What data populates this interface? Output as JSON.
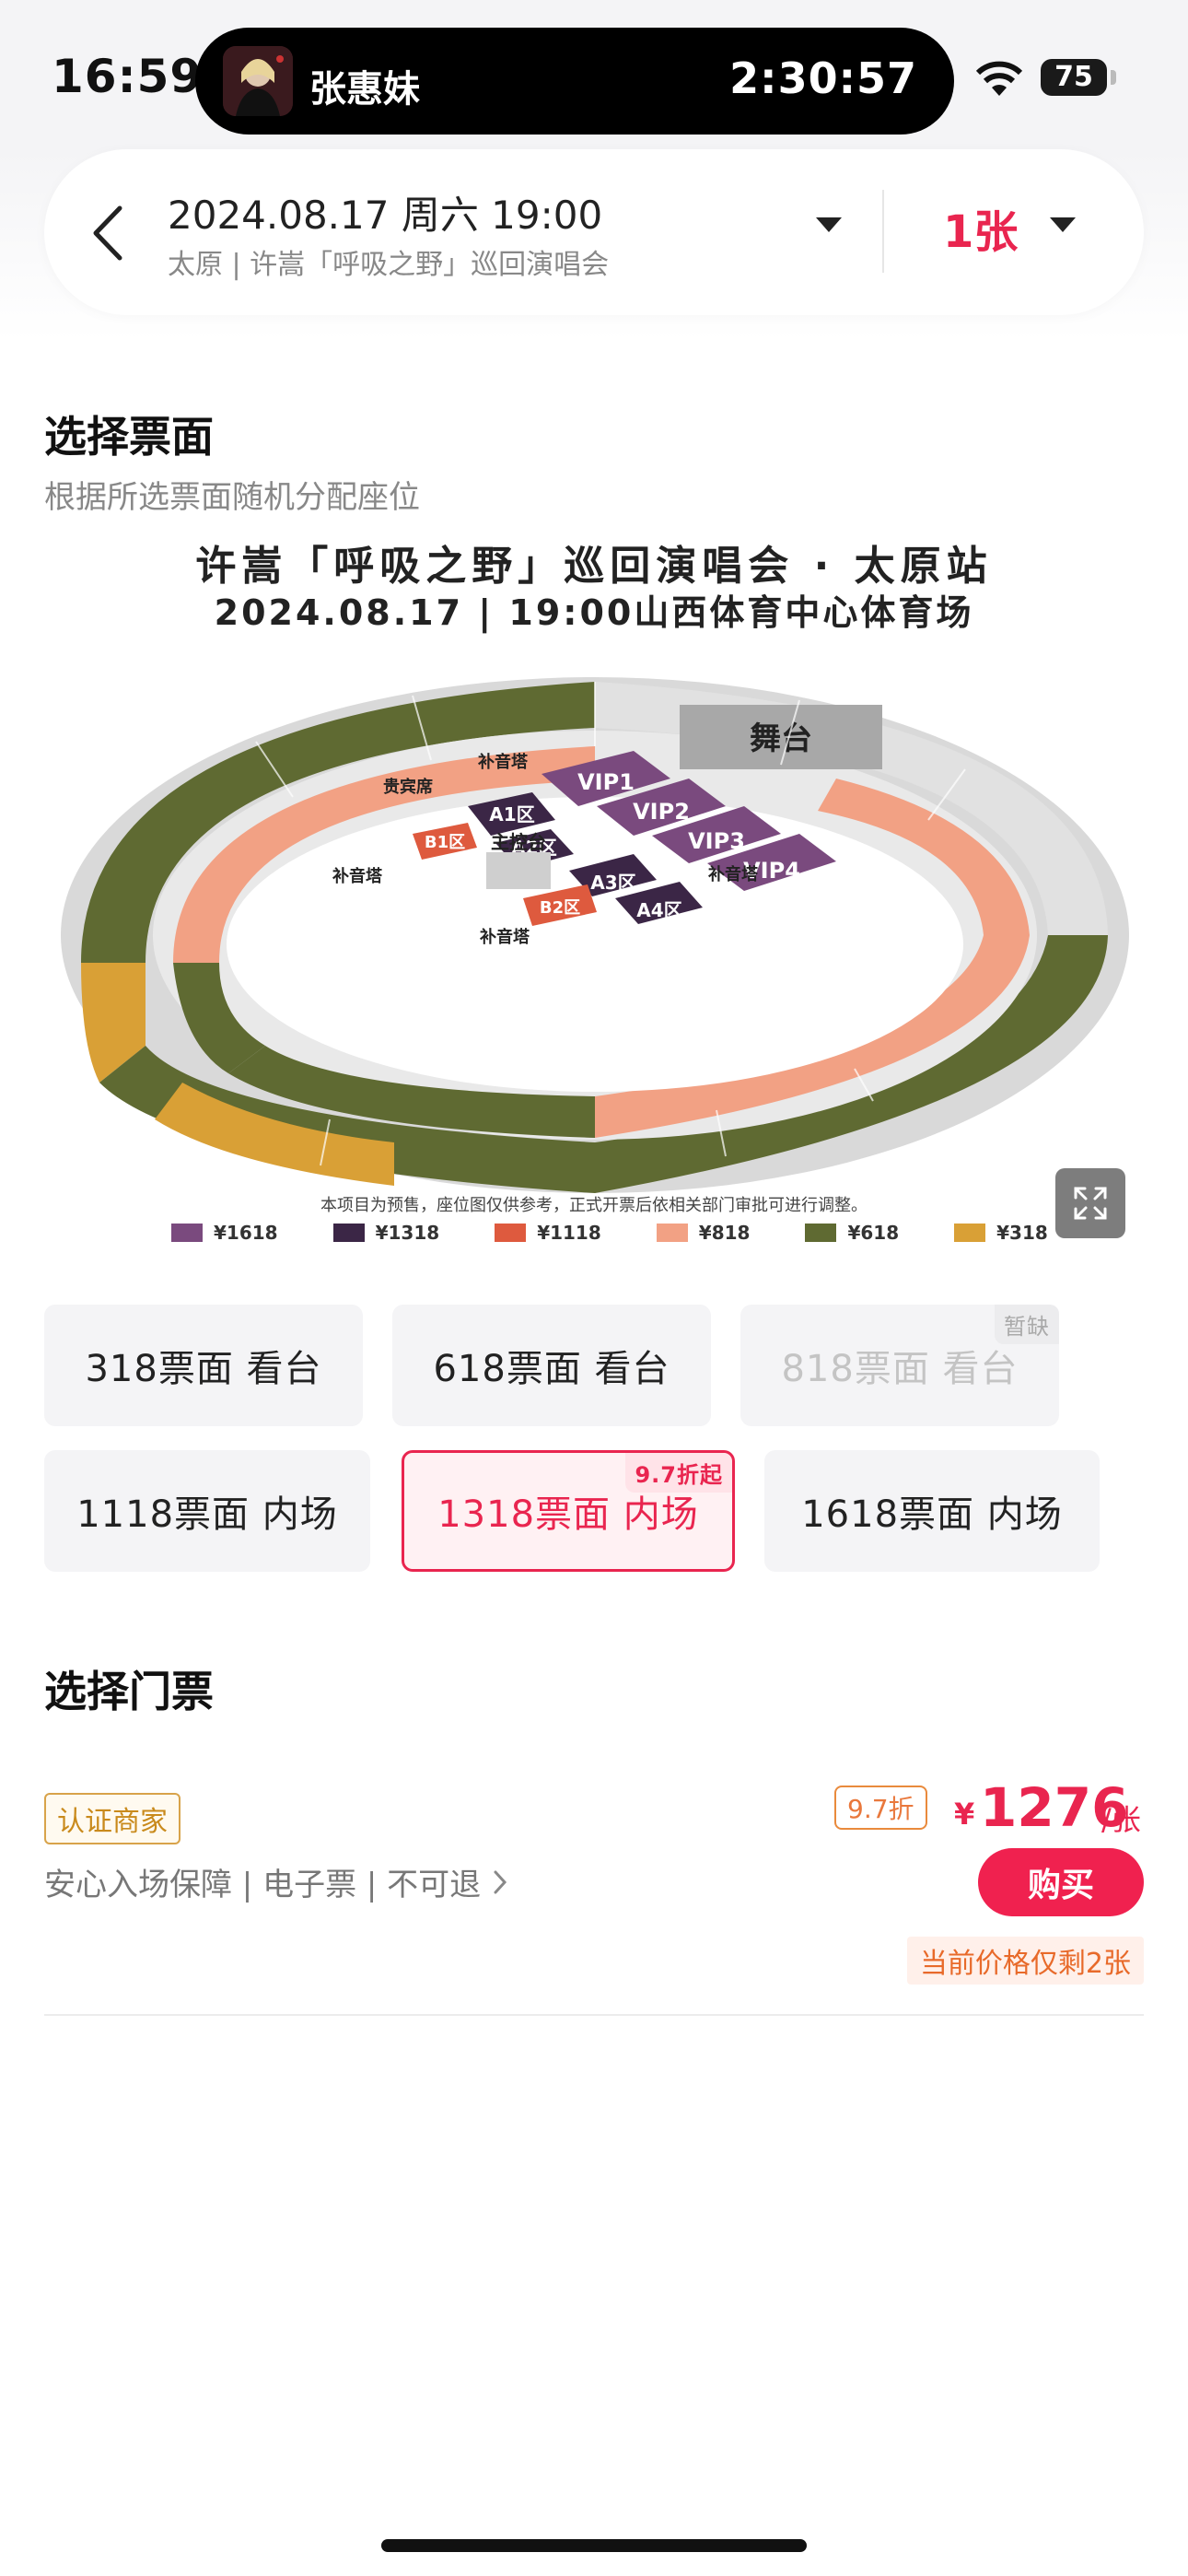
{
  "status_bar": {
    "time": "16:59",
    "battery": "75"
  },
  "live_activity": {
    "artist": "张惠妹",
    "timer": "2:30:57"
  },
  "header": {
    "date": "2024.08.17 周六 19:00",
    "subtitle": "太原 | 许嵩「呼吸之野」巡回演唱会",
    "quantity": "1张"
  },
  "seat_section": {
    "title": "选择票面",
    "subtitle": "根据所选票面随机分配座位"
  },
  "seat_map": {
    "title": "许嵩「呼吸之野」巡回演唱会 · 太原站",
    "subtitle": "2024.08.17 | 19:00山西体育中心体育场",
    "note": "本项目为预售，座位图仅供参考，正式开票后依相关部门审批可进行调整。",
    "stage": "舞台",
    "control": "主控台",
    "tower": "补音塔",
    "vip_box": "贵宾席",
    "legend": [
      {
        "label": "¥1618",
        "color": "#7a4a7e"
      },
      {
        "label": "¥1318",
        "color": "#3b2646"
      },
      {
        "label": "¥1118",
        "color": "#de5a3e"
      },
      {
        "label": "¥818",
        "color": "#f2a184"
      },
      {
        "label": "¥618",
        "color": "#5f6a32"
      },
      {
        "label": "¥318",
        "color": "#d9a036"
      }
    ],
    "sections": {
      "vip": [
        "VIP1",
        "VIP2",
        "VIP3",
        "VIP4"
      ],
      "a": [
        "A1区",
        "A2区",
        "A3区",
        "A4区"
      ],
      "b": [
        "B1区",
        "B2区"
      ]
    }
  },
  "tiers": [
    {
      "label": "318票面 看台",
      "badge": ""
    },
    {
      "label": "618票面 看台",
      "badge": ""
    },
    {
      "label": "818票面 看台",
      "badge": "暂缺"
    },
    {
      "label": "1118票面 内场",
      "badge": ""
    },
    {
      "label": "1318票面 内场",
      "badge": "9.7折起"
    },
    {
      "label": "1618票面 内场",
      "badge": ""
    }
  ],
  "ticket_section": {
    "title": "选择门票"
  },
  "listing": {
    "merchant": "认证商家",
    "guarantee": "安心入场保障 | 电子票 | 不可退",
    "discount": "9.7折",
    "currency": "¥",
    "price": "1276",
    "unit": "/张",
    "buy": "购买",
    "stock": "当前价格仅剩2张"
  }
}
